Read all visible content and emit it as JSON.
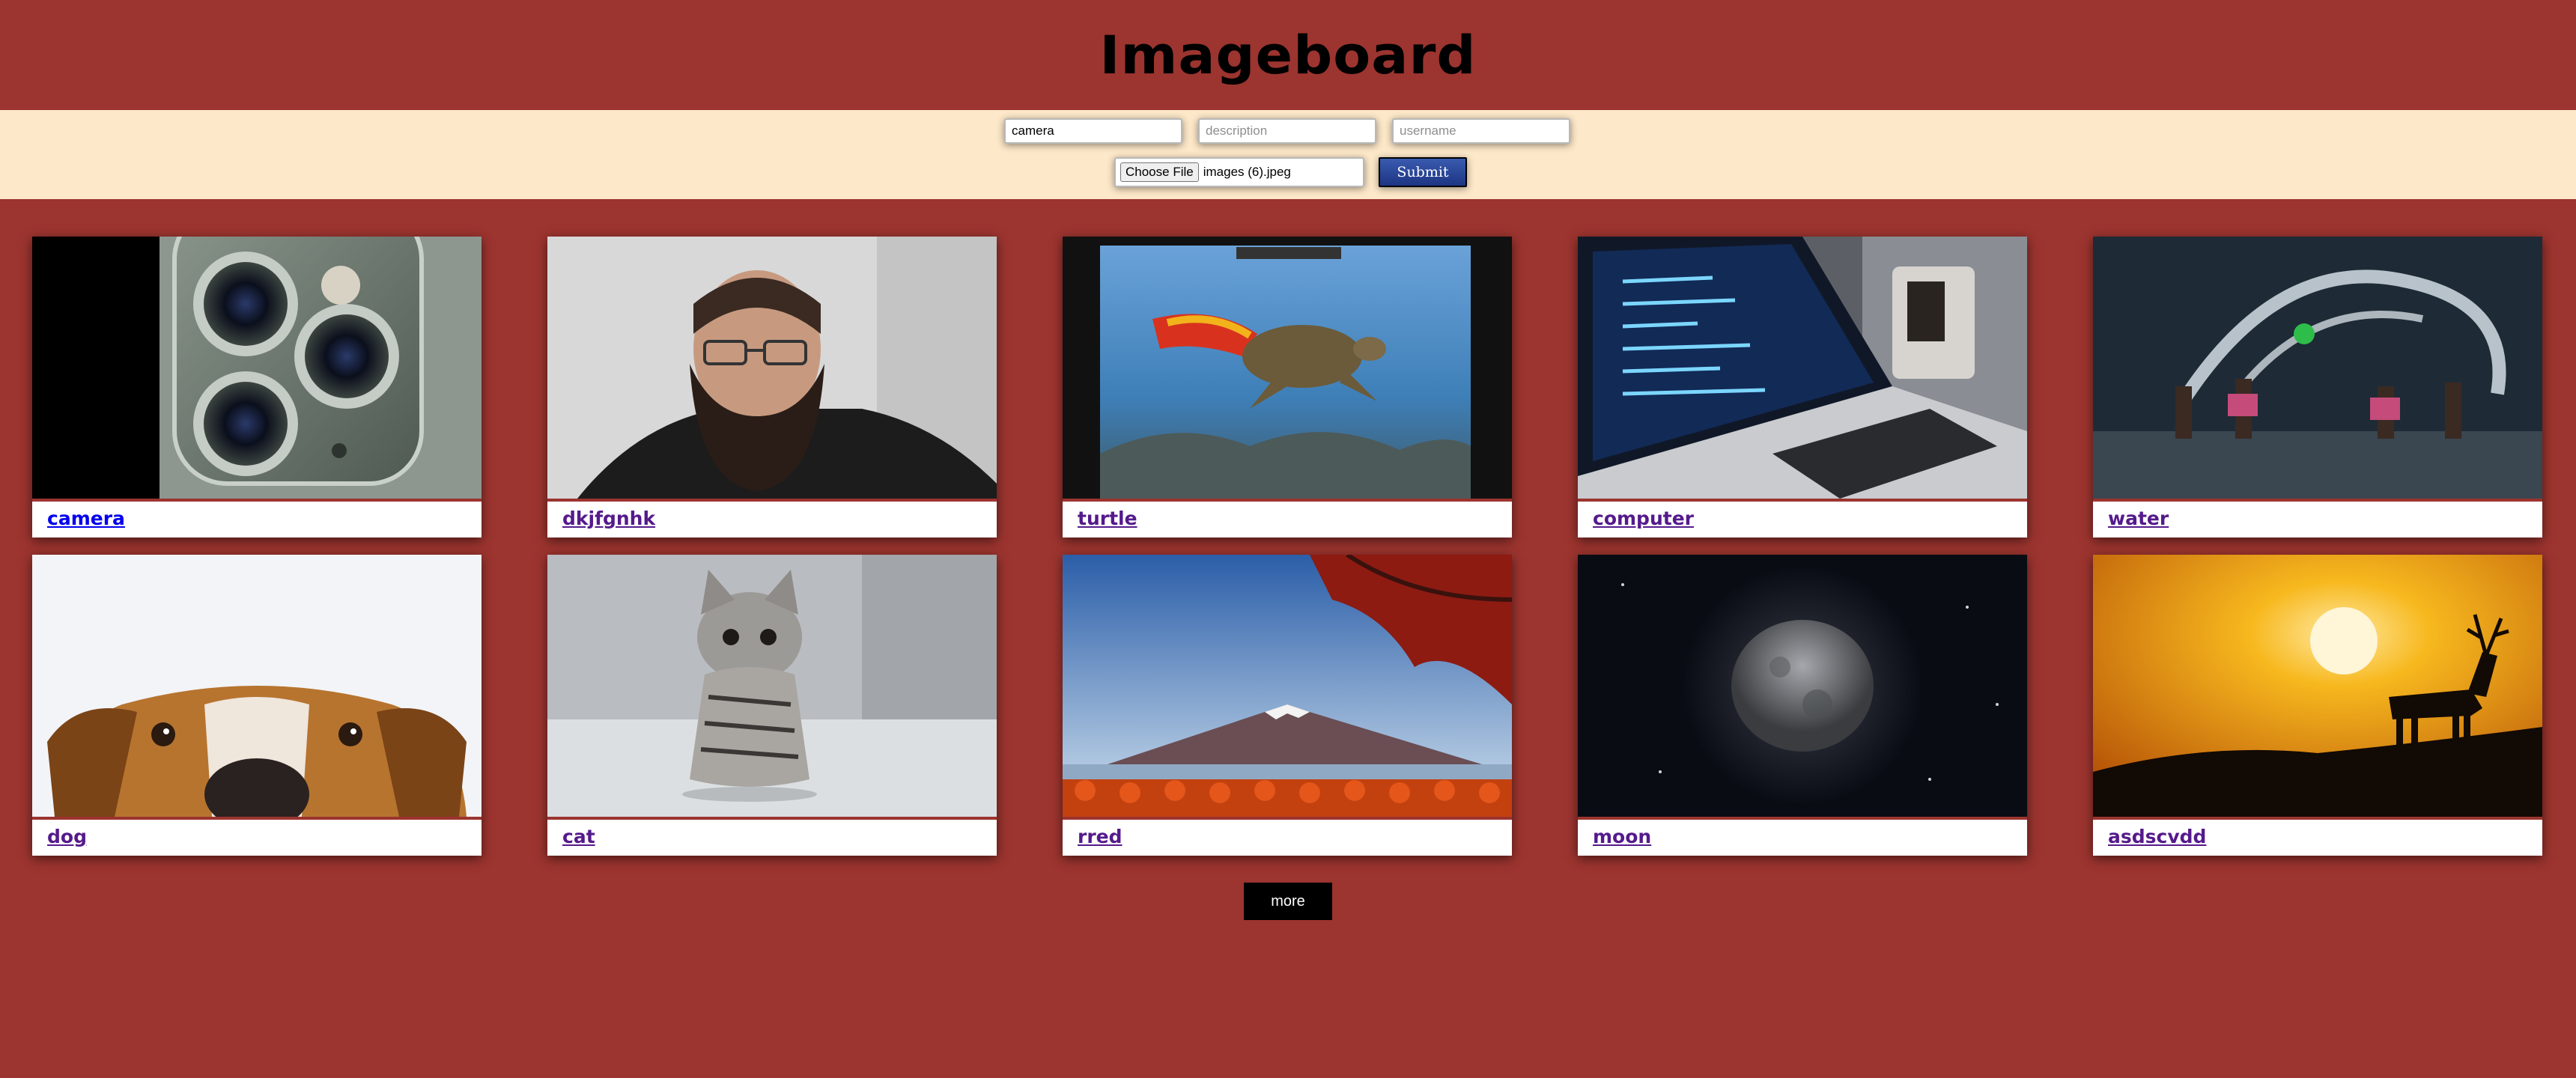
{
  "header": {
    "title": "Imageboard"
  },
  "form": {
    "title_value": "camera",
    "description_placeholder": "description",
    "username_placeholder": "username",
    "choose_file_label": "Choose File",
    "file_name": "images (6).jpeg",
    "submit_label": "Submit"
  },
  "images": [
    {
      "title": "camera"
    },
    {
      "title": "dkjfgnhk"
    },
    {
      "title": "turtle"
    },
    {
      "title": "computer"
    },
    {
      "title": "water"
    },
    {
      "title": "dog"
    },
    {
      "title": "cat"
    },
    {
      "title": "rred"
    },
    {
      "title": "moon"
    },
    {
      "title": "asdscvdd"
    }
  ],
  "more_label": "more"
}
